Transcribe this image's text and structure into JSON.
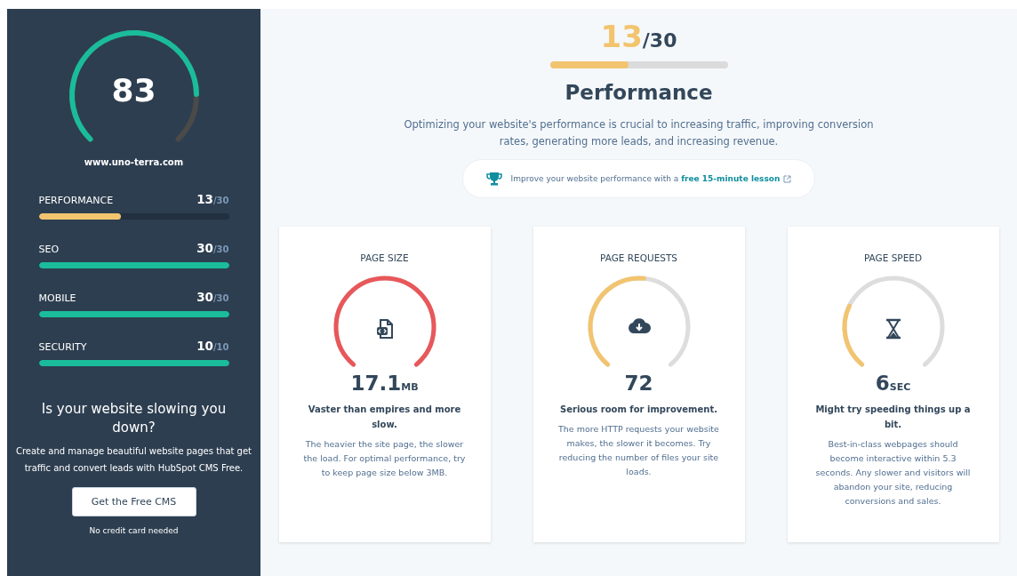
{
  "sidebar": {
    "score": "83",
    "url": "www.uno-terra.com",
    "categories": [
      {
        "label": "PERFORMANCE",
        "score": "13",
        "total": "/30",
        "level": 0.43,
        "color": "#f2c46f"
      },
      {
        "label": "SEO",
        "score": "30",
        "total": "/30",
        "level": 1,
        "color": "#1abc9c"
      },
      {
        "label": "MOBILE",
        "score": "30",
        "total": "/30",
        "level": 1,
        "color": "#1abc9c"
      },
      {
        "label": "SECURITY",
        "score": "10",
        "total": "/10",
        "level": 1,
        "color": "#1abc9c"
      }
    ],
    "promo": {
      "heading": "Is your website slowing you down?",
      "text": "Create and manage beautiful website pages that get traffic and convert leads with HubSpot CMS Free.",
      "button": "Get the Free CMS",
      "note": "No credit card needed"
    }
  },
  "main": {
    "score": "13",
    "total": "/30",
    "level": 0.44,
    "title": "Performance",
    "description": "Optimizing your website's performance is crucial to increasing traffic, improving conversion rates, generating more leads, and increasing revenue.",
    "tip": {
      "text": "Improve your website performance with a",
      "link": "free 15-minute lesson"
    },
    "cards": [
      {
        "title": "PAGE SIZE",
        "kind": "file",
        "color": "#e8575a",
        "value": "17.1",
        "unit": "MB",
        "verdict": "Vaster than empires and more slow.",
        "description": "The heavier the site page, the slower the load. For optimal performance, try to keep page size below 3MB."
      },
      {
        "title": "PAGE REQUESTS",
        "kind": "cloud",
        "color": "#f2c46f",
        "value": "72",
        "verdict": "Serious room for improvement.",
        "description": "The more HTTP requests your website makes, the slower it becomes. Try reducing the number of files your site loads."
      },
      {
        "title": "PAGE SPEED",
        "kind": "hourglass",
        "color": "#f2c46f",
        "value": "6",
        "unit": "SEC",
        "verdict": "Might try speeding things up a bit.",
        "description": "Best-in-class webpages should become interactive within 5.3 seconds. Any slower and visitors will abandon your site, reducing conversions and sales."
      }
    ]
  }
}
